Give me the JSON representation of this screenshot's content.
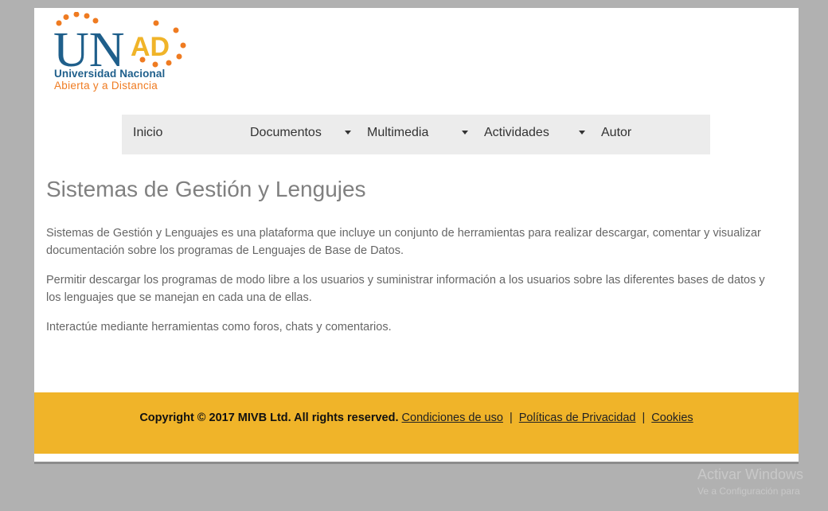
{
  "logo": {
    "letters_u_n": "UN",
    "letters_ad": "AD",
    "line1": "Universidad Nacional",
    "line2": "Abierta y a Distancia"
  },
  "nav": {
    "items": [
      {
        "label": "Inicio",
        "has_dropdown": false
      },
      {
        "label": "Documentos",
        "has_dropdown": true
      },
      {
        "label": "Multimedia",
        "has_dropdown": true
      },
      {
        "label": "Actividades",
        "has_dropdown": true
      },
      {
        "label": "Autor",
        "has_dropdown": false
      }
    ]
  },
  "main": {
    "title": "Sistemas de Gestión y Lengujes",
    "paragraphs": [
      "Sistemas de Gestión y Lenguajes es una plataforma que incluye un conjunto de herramientas para realizar descargar, comentar y visualizar documentación sobre los programas de Lenguajes de Base de Datos.",
      "Permitir descargar los programas de modo libre a los usuarios y suministrar información a los usuarios sobre las diferentes bases de datos y los lenguajes que se manejan en cada una de ellas.",
      "Interactúe mediante herramientas como foros, chats y comentarios."
    ]
  },
  "footer": {
    "copyright": "Copyright © 2017 MIVB Ltd. All rights reserved.",
    "links": [
      "Condiciones de uso",
      "Políticas de Privacidad",
      "Cookies"
    ],
    "separator": "|"
  },
  "watermark": {
    "line1": "Activar Windows",
    "line2": "Ve a Configuración para"
  },
  "colors": {
    "footer_bg": "#f0b429",
    "logo_blue": "#1f5f8b",
    "logo_orange": "#ef7b21",
    "logo_yellow": "#f0b429"
  }
}
